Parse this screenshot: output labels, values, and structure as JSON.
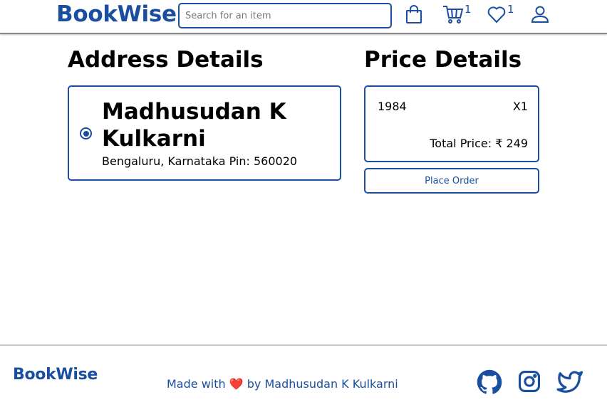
{
  "header": {
    "brand": "BookWise",
    "search_placeholder": "Search for an item",
    "cart_count": "1",
    "wishlist_count": "1"
  },
  "address": {
    "title": "Address Details",
    "name": "Madhusudan K Kulkarni",
    "line": "Bengaluru, Karnataka Pin: 560020"
  },
  "price": {
    "title": "Price Details",
    "item_name": "1984",
    "item_qty": "X1",
    "total": "Total Price: ₹ 249",
    "place_order_label": "Place Order"
  },
  "footer": {
    "brand": "BookWise",
    "made_with_prefix": "Made with",
    "heart": "❤️",
    "made_with_suffix": "by Madhusudan K Kulkarni"
  },
  "colors": {
    "brand": "#1a4fa0",
    "heart": "#e53935"
  },
  "icons": [
    "shopping-bag-icon",
    "cart-icon",
    "heart-icon",
    "user-icon",
    "github-icon",
    "instagram-icon",
    "twitter-icon"
  ]
}
